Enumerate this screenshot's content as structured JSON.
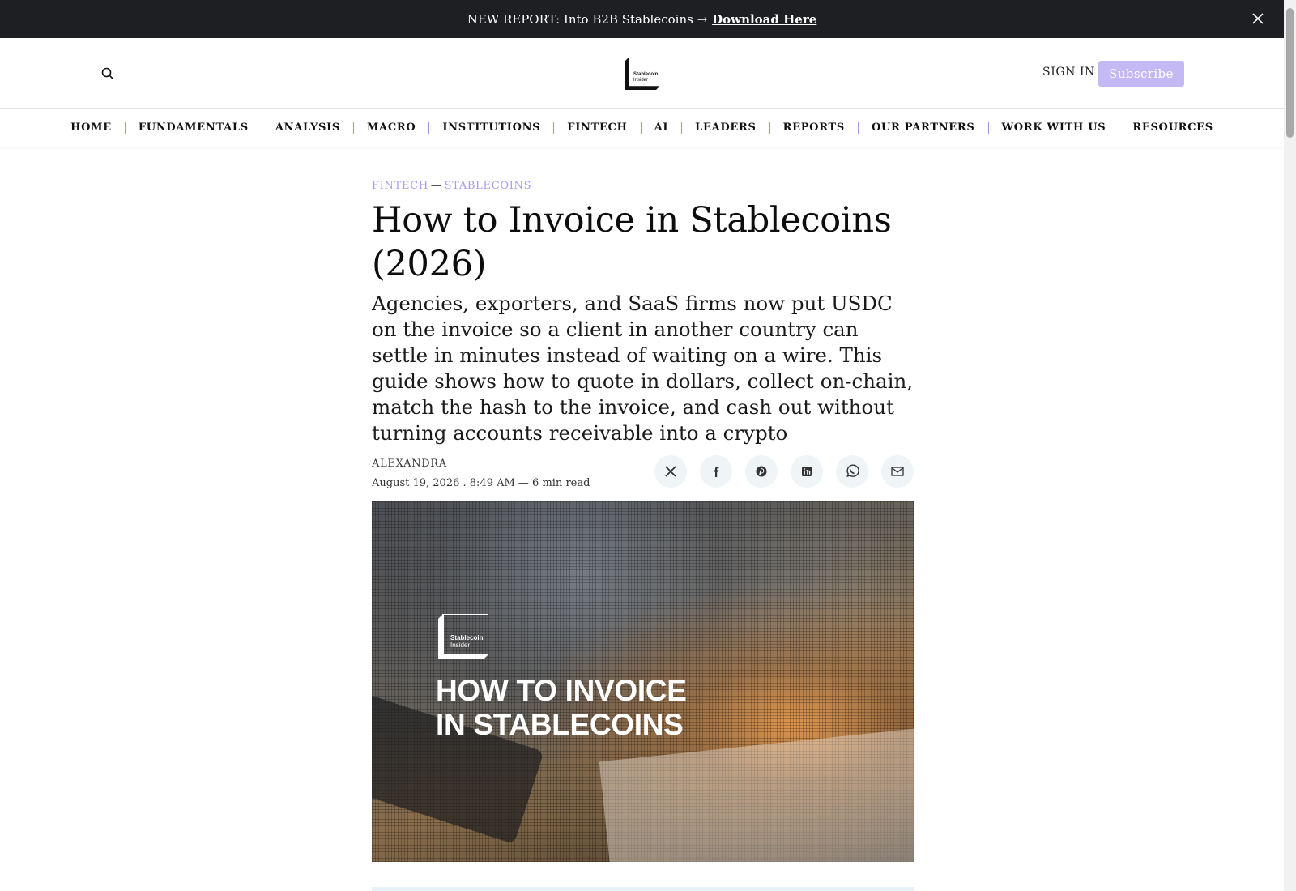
{
  "announcement": {
    "text": "NEW REPORT: Into B2B Stablecoins →",
    "link": "Download Here",
    "close_icon": "close-icon"
  },
  "header": {
    "search_icon": "search-icon",
    "logo_line1": "Stablecoin",
    "logo_line2": "Insider",
    "signin": "SIGN IN",
    "subscribe": "Subscribe",
    "accent_color": "#c4b8f5"
  },
  "nav": {
    "items": [
      "HOME",
      "FUNDAMENTALS",
      "ANALYSIS",
      "MACRO",
      "INSTITUTIONS",
      "FINTECH",
      "AI",
      "LEADERS",
      "REPORTS",
      "OUR PARTNERS",
      "WORK WITH US",
      "RESOURCES"
    ]
  },
  "article": {
    "kicker_category": "FINTECH",
    "kicker_sep": "—",
    "kicker_subcategory": "STABLECOINS",
    "title": "How to Invoice in Stablecoins (2026)",
    "dek": "Agencies, exporters, and SaaS firms now put USDC on the invoice so a client in another country can settle in minutes instead of waiting on a wire. This guide shows how to quote in dollars, collect on-chain, match the hash to the invoice, and cash out without turning accounts receivable into a crypto",
    "author": "ALEXANDRA",
    "meta": "August 19, 2026 . 8:49 AM — 6 min read",
    "share_icons": [
      "x-icon",
      "facebook-icon",
      "pinterest-icon",
      "linkedin-icon",
      "whatsapp-icon",
      "email-icon"
    ]
  },
  "hero": {
    "logo_line1": "Stablecoin",
    "logo_line2": "Insider",
    "title_line1": "HOW TO INVOICE",
    "title_line2": "IN STABLECOINS"
  }
}
